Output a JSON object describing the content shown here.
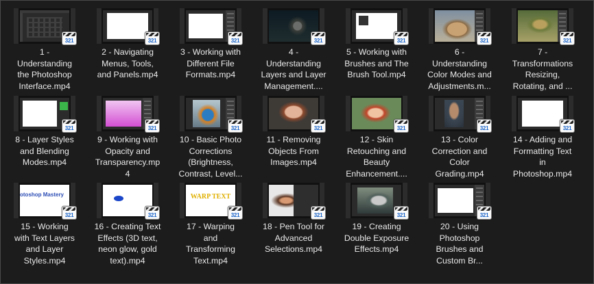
{
  "window": {
    "title": ""
  },
  "badge_text": "321",
  "items": [
    {
      "label": "1 -\nUnderstanding\nthe Photoshop\nInterface.mp4",
      "thumb": "dark-ui-grid"
    },
    {
      "label": "2 - Navigating\nMenus, Tools,\nand Panels.mp4",
      "thumb": "white-canvas"
    },
    {
      "label": "3 - Working with\nDifferent File\nFormats.mp4",
      "thumb": "white-canvas-panel"
    },
    {
      "label": "4 -\nUnderstanding\nLayers and Layer\nManagement....",
      "thumb": "owl"
    },
    {
      "label": "5 - Working with\nBrushes and The\nBrush Tool.mp4",
      "thumb": "brush-dialog"
    },
    {
      "label": "6 -\nUnderstanding\nColor Modes and\nAdjustments.m...",
      "thumb": "dog"
    },
    {
      "label": "7 -\nTransformations\nResizing,\nRotating, and ...",
      "thumb": "painting"
    },
    {
      "label": "8 - Layer Styles\nand Blending\nModes.mp4",
      "thumb": "white-green"
    },
    {
      "label": "9 - Working with\nOpacity and\nTransparency.mp\n4",
      "thumb": "pink-gradient"
    },
    {
      "label": "10 - Basic Photo\nCorrections\n(Brightness,\nContrast, Level...",
      "thumb": "kingfisher"
    },
    {
      "label": "11 - Removing\nObjects From\nImages.mp4",
      "thumb": "boy-portrait"
    },
    {
      "label": "12 - Skin\nRetouching and\nBeauty\nEnhancement....",
      "thumb": "girl-portrait"
    },
    {
      "label": "13 - Color\nCorrection and\nColor\nGrading.mp4",
      "thumb": "man-portrait"
    },
    {
      "label": "14 - Adding and\nFormatting Text\nin\nPhotoshop.mp4",
      "thumb": "white-canvas"
    },
    {
      "label": "15 - Working\nwith Text Layers\nand Layer\nStyles.mp4",
      "thumb": "text-canvas",
      "thumb_text": "otoshop Mastery"
    },
    {
      "label": "16 - Creating Text\nEffects (3D text,\nneon glow, gold\ntext).mp4",
      "thumb": "blue-blob"
    },
    {
      "label": "17 - Warping\nand\nTransforming\nText.mp4",
      "thumb": "warp-text",
      "thumb_text": "WARP TEXT"
    },
    {
      "label": "18 - Pen Tool for\nAdvanced\nSelections.mp4",
      "thumb": "curly-portrait"
    },
    {
      "label": "19 - Creating\nDouble Exposure\nEffects.mp4",
      "thumb": "double-exposure"
    },
    {
      "label": "20 - Using\nPhotoshop\nBrushes and\nCustom Br...",
      "thumb": "white-panel"
    }
  ]
}
